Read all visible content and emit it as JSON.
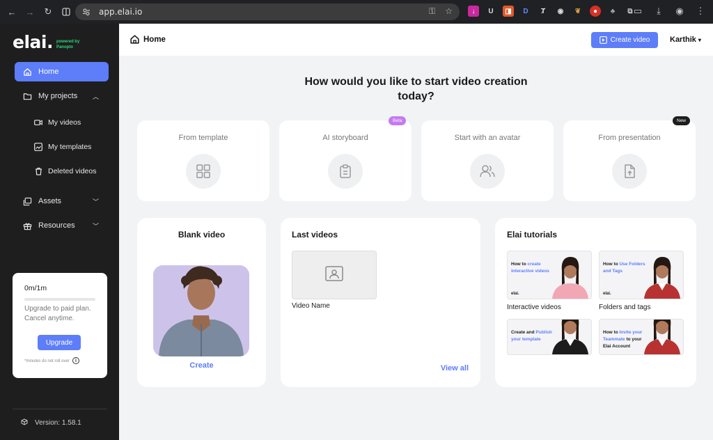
{
  "browser": {
    "url": "app.elai.io"
  },
  "sidebar": {
    "logo": "elai.",
    "powered_line1": "powered by",
    "powered_line2": "Panopto",
    "items": {
      "home": "Home",
      "my_projects": "My projects",
      "my_videos": "My videos",
      "my_templates": "My templates",
      "deleted_videos": "Deleted videos",
      "assets": "Assets",
      "resources": "Resources"
    },
    "upgrade": {
      "usage": "0m/1m",
      "usage_fraction": 0,
      "message": "Upgrade to paid plan. Cancel anytime.",
      "button": "Upgrade",
      "note": "*minutes do not roll over"
    },
    "version": "Version: 1.58.1"
  },
  "header": {
    "title": "Home",
    "create_button": "Create video",
    "user": "Karthik"
  },
  "main": {
    "heading": "How would you like to start video creation today?",
    "start_options": [
      {
        "label": "From template",
        "icon": "grid-icon"
      },
      {
        "label": "AI storyboard",
        "icon": "clipboard-icon",
        "badge": "Beta"
      },
      {
        "label": "Start with an avatar",
        "icon": "users-icon"
      },
      {
        "label": "From presentation",
        "icon": "file-upload-icon",
        "badge": "New"
      }
    ],
    "blank_video": {
      "title": "Blank video",
      "create": "Create"
    },
    "last_videos": {
      "title": "Last videos",
      "video_name": "Video Name",
      "view_all": "View all"
    },
    "tutorials": {
      "title": "Elai tutorials",
      "items": [
        {
          "pre": "How to ",
          "hl": "create interactive videos",
          "post": "",
          "label": "Interactive videos"
        },
        {
          "pre": "How to ",
          "hl": "Use Folders and Tags",
          "post": "",
          "label": "Folders and tags"
        },
        {
          "pre": "Create and ",
          "hl": "Publish your template",
          "post": "",
          "label": ""
        },
        {
          "pre": "How to ",
          "hl": "Invite your Teammate",
          "post": " to your Elai Account",
          "label": ""
        }
      ],
      "thumb_logo": "elai."
    }
  },
  "colors": {
    "accent": "#5d7df9",
    "sidebar_bg": "#1e1e1e",
    "beta_badge": "#c57bf0",
    "new_badge": "#1e1e1e"
  }
}
